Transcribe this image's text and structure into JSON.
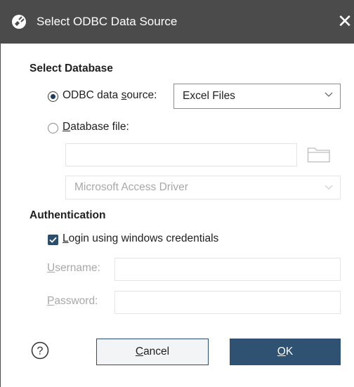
{
  "window": {
    "title": "Select ODBC Data Source",
    "close_glyph": "✕"
  },
  "select_database": {
    "heading": "Select Database",
    "odbc_option": {
      "prefix": "ODBC data ",
      "accel": "s",
      "suffix": "ource:",
      "selected": true
    },
    "odbc_source": {
      "value": "Excel Files"
    },
    "file_option": {
      "prefix": "",
      "accel": "D",
      "suffix": "atabase file:",
      "selected": false
    },
    "file_path": {
      "value": ""
    },
    "driver": {
      "value": "Microsoft Access Driver"
    }
  },
  "authentication": {
    "heading": "Authentication",
    "windows_login": {
      "accel": "L",
      "suffix": "ogin using windows credentials",
      "checked": true
    },
    "username": {
      "accel": "U",
      "suffix": "sername:",
      "value": ""
    },
    "password": {
      "accel": "P",
      "suffix": "assword:",
      "value": ""
    }
  },
  "buttons": {
    "help": "?",
    "cancel": {
      "accel": "C",
      "suffix": "ancel"
    },
    "ok": {
      "accel": "O",
      "suffix": "K"
    }
  },
  "colors": {
    "titlebar": "#4b4b4b",
    "accent": "#2f5272",
    "disabled_text": "#a8a8a8"
  }
}
